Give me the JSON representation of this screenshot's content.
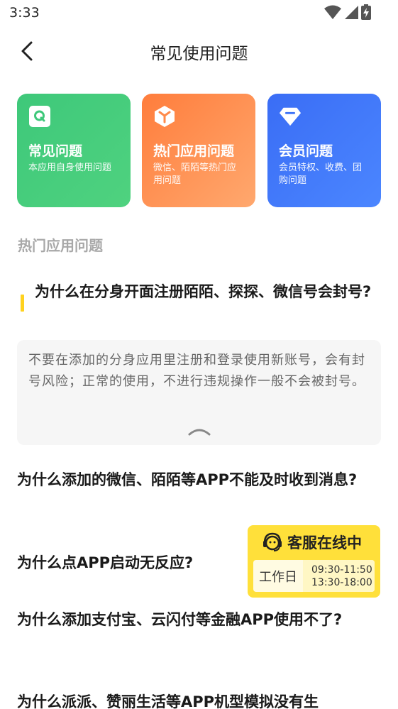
{
  "status_bar": {
    "time": "3:33",
    "icons": [
      "wifi-icon",
      "signal-icon",
      "battery-charging-icon"
    ]
  },
  "header": {
    "back_icon": "chevron-left-icon",
    "title": "常见使用问题"
  },
  "categories": [
    {
      "icon": "q-icon",
      "title": "常见问题",
      "desc": "本应用自身使用问题",
      "color": "#3ec87a"
    },
    {
      "icon": "cube-icon",
      "title": "热门应用问题",
      "desc": "微信、陌陌等热门应用问题",
      "color": "#ff8a4a"
    },
    {
      "icon": "diamond-icon",
      "title": "会员问题",
      "desc": "会员特权、收费、团购问题",
      "color": "#3f74f7"
    }
  ],
  "section": {
    "title": "热门应用问题"
  },
  "faq": {
    "expanded": {
      "question": "为什么在分身开面注册陌陌、探探、微信号会封号?",
      "answer": "不要在添加的分身应用里注册和登录使用新账号，会有封号风险；正常的使用，不进行违规操作一般不会被封号。",
      "accent": "#ffd21f"
    },
    "items": [
      "为什么添加的微信、陌陌等APP不能及时收到消息?",
      "为什么点APP启动无反应?",
      "为什么添加支付宝、云闪付等金融APP使用不了?",
      "为什么派派、赞丽生活等APP机型模拟没有生"
    ]
  },
  "customer_service": {
    "icon": "headset-icon",
    "title": "客服在线中",
    "workday_label": "工作日",
    "hours": [
      "09:30-11:50",
      "13:30-18:00"
    ],
    "color": "#ffe03a"
  }
}
